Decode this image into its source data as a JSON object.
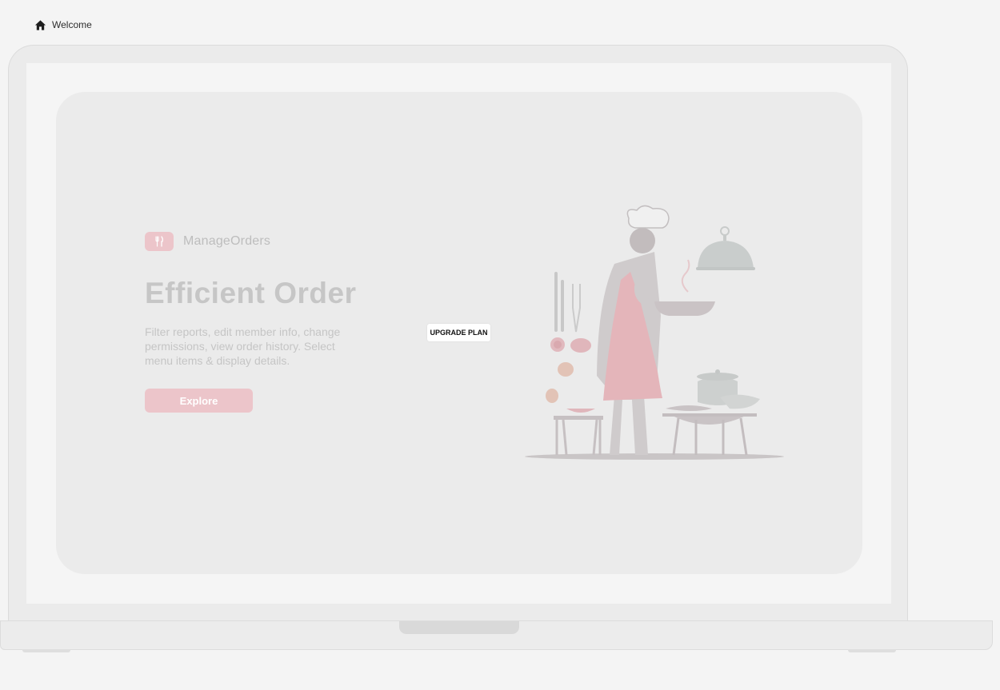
{
  "breadcrumb": {
    "icon": "home-icon",
    "label": "Welcome"
  },
  "brand": {
    "icon": "utensils-icon",
    "name": "ManageOrders"
  },
  "hero": {
    "title": "Efficient Order",
    "description": "Filter reports, edit member info, change permissions, view order history. Select menu items & display details.",
    "explore_label": "Explore"
  },
  "upgrade": {
    "label": "UPGRADE PLAN"
  },
  "illustration": {
    "icon": "chef-cooking-illustration"
  },
  "colors": {
    "accent": "#ecc5ca",
    "background": "#f4f4f4",
    "card": "#ebebeb",
    "muted_text": "#c5c5c5"
  }
}
